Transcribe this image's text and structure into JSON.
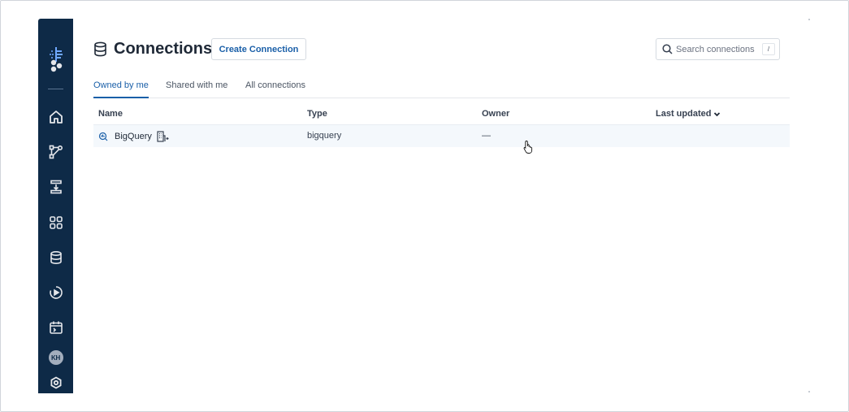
{
  "sidebar": {
    "items": [
      {
        "icon": "logo-icon"
      },
      {
        "icon": "nodes-icon"
      },
      {
        "icon": "home-icon"
      },
      {
        "icon": "pipeline-icon"
      },
      {
        "icon": "transform-icon"
      },
      {
        "icon": "apps-icon"
      },
      {
        "icon": "database-icon"
      },
      {
        "icon": "play-circle-icon"
      },
      {
        "icon": "calendar-icon"
      }
    ],
    "avatar_initials": "KH",
    "settings_icon": "settings-icon"
  },
  "header": {
    "title": "Connections",
    "create_button": "Create Connection",
    "search_placeholder": "Search connections",
    "search_shortcut": "/"
  },
  "tabs": [
    {
      "label": "Owned by me",
      "active": true
    },
    {
      "label": "Shared with me",
      "active": false
    },
    {
      "label": "All connections",
      "active": false
    }
  ],
  "table": {
    "columns": {
      "name": "Name",
      "type": "Type",
      "owner": "Owner",
      "last_updated": "Last updated"
    },
    "rows": [
      {
        "name": "BigQuery",
        "type": "bigquery",
        "owner": "—",
        "last_updated": ""
      }
    ]
  },
  "colors": {
    "sidebar_bg": "#0e2a47",
    "accent": "#1a5fa8",
    "row_hover": "#f4f8fc"
  }
}
